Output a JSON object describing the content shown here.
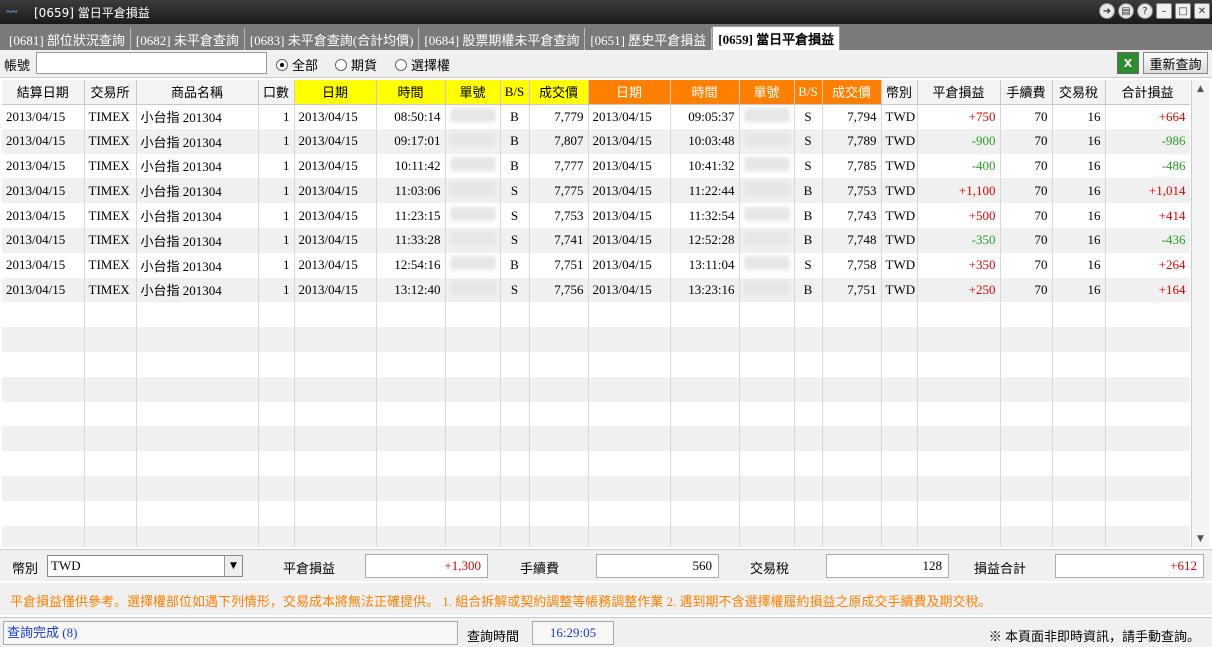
{
  "window": {
    "title": "[0659] 當日平倉損益"
  },
  "tabs": [
    {
      "label": "[0681] 部位狀況查詢",
      "active": false
    },
    {
      "label": "[0682] 未平倉查詢",
      "active": false
    },
    {
      "label": "[0683] 未平倉查詢(合計均價)",
      "active": false
    },
    {
      "label": "[0684] 股票期權未平倉查詢",
      "active": false
    },
    {
      "label": "[0651] 歷史平倉損益",
      "active": false
    },
    {
      "label": "[0659] 當日平倉損益",
      "active": true
    }
  ],
  "toolbar": {
    "account_label": "帳號",
    "account_value": "",
    "radios": [
      {
        "label": "全部",
        "checked": true
      },
      {
        "label": "期貨",
        "checked": false
      },
      {
        "label": "選擇權",
        "checked": false
      }
    ],
    "excel_icon": "excel-export-icon",
    "requery_label": "重新查詢"
  },
  "table": {
    "headers": [
      "結算日期",
      "交易所",
      "商品名稱",
      "口數",
      "日期",
      "時間",
      "單號",
      "B/S",
      "成交價",
      "日期",
      "時間",
      "單號",
      "B/S",
      "成交價",
      "幣別",
      "平倉損益",
      "手續費",
      "交易稅",
      "合計損益"
    ],
    "rows": [
      [
        "2013/04/15",
        "TIMEX",
        "小台指  201304",
        "1",
        "2013/04/15",
        "08:50:14",
        "",
        "B",
        "7,779",
        "2013/04/15",
        "09:05:37",
        "",
        "S",
        "7,794",
        "TWD",
        "+750",
        "70",
        "16",
        "+664"
      ],
      [
        "2013/04/15",
        "TIMEX",
        "小台指  201304",
        "1",
        "2013/04/15",
        "09:17:01",
        "",
        "B",
        "7,807",
        "2013/04/15",
        "10:03:48",
        "",
        "S",
        "7,789",
        "TWD",
        "-900",
        "70",
        "16",
        "-986"
      ],
      [
        "2013/04/15",
        "TIMEX",
        "小台指  201304",
        "1",
        "2013/04/15",
        "10:11:42",
        "",
        "B",
        "7,777",
        "2013/04/15",
        "10:41:32",
        "",
        "S",
        "7,785",
        "TWD",
        "-400",
        "70",
        "16",
        "-486"
      ],
      [
        "2013/04/15",
        "TIMEX",
        "小台指  201304",
        "1",
        "2013/04/15",
        "11:03:06",
        "",
        "S",
        "7,775",
        "2013/04/15",
        "11:22:44",
        "",
        "B",
        "7,753",
        "TWD",
        "+1,100",
        "70",
        "16",
        "+1,014"
      ],
      [
        "2013/04/15",
        "TIMEX",
        "小台指  201304",
        "1",
        "2013/04/15",
        "11:23:15",
        "",
        "S",
        "7,753",
        "2013/04/15",
        "11:32:54",
        "",
        "B",
        "7,743",
        "TWD",
        "+500",
        "70",
        "16",
        "+414"
      ],
      [
        "2013/04/15",
        "TIMEX",
        "小台指  201304",
        "1",
        "2013/04/15",
        "11:33:28",
        "",
        "S",
        "7,741",
        "2013/04/15",
        "12:52:28",
        "",
        "B",
        "7,748",
        "TWD",
        "-350",
        "70",
        "16",
        "-436"
      ],
      [
        "2013/04/15",
        "TIMEX",
        "小台指  201304",
        "1",
        "2013/04/15",
        "12:54:16",
        "",
        "B",
        "7,751",
        "2013/04/15",
        "13:11:04",
        "",
        "S",
        "7,758",
        "TWD",
        "+350",
        "70",
        "16",
        "+264"
      ],
      [
        "2013/04/15",
        "TIMEX",
        "小台指  201304",
        "1",
        "2013/04/15",
        "13:12:40",
        "",
        "S",
        "7,756",
        "2013/04/15",
        "13:23:16",
        "",
        "B",
        "7,751",
        "TWD",
        "+250",
        "70",
        "16",
        "+164"
      ]
    ]
  },
  "summary": {
    "currency_label": "幣別",
    "currency_value": "TWD",
    "pnl_label": "平倉損益",
    "pnl_value": "+1,300",
    "fee_label": "手續費",
    "fee_value": "560",
    "tax_label": "交易稅",
    "tax_value": "128",
    "total_label": "損益合計",
    "total_value": "+612"
  },
  "notice": "平倉損益僅供參考。選擇權部位如遇下列情形，交易成本將無法正確提供。   1. 組合拆解或契約調整等帳務調整作業   2. 遇到期不含選擇權履約損益之原成交手續費及期交稅。",
  "status": {
    "left": "查詢完成 (8)",
    "query_time_label": "查詢時間",
    "query_time": "16:29:05",
    "right": "※ 本頁面非即時資訊，請手動查詢。"
  },
  "colors": {
    "positive": "#e00000",
    "negative": "#2a9a2a",
    "yellow_header": "#ffff00",
    "orange_header": "#ff7f00",
    "notice_text": "#ff7f00",
    "status_text": "#1a3ad0"
  }
}
